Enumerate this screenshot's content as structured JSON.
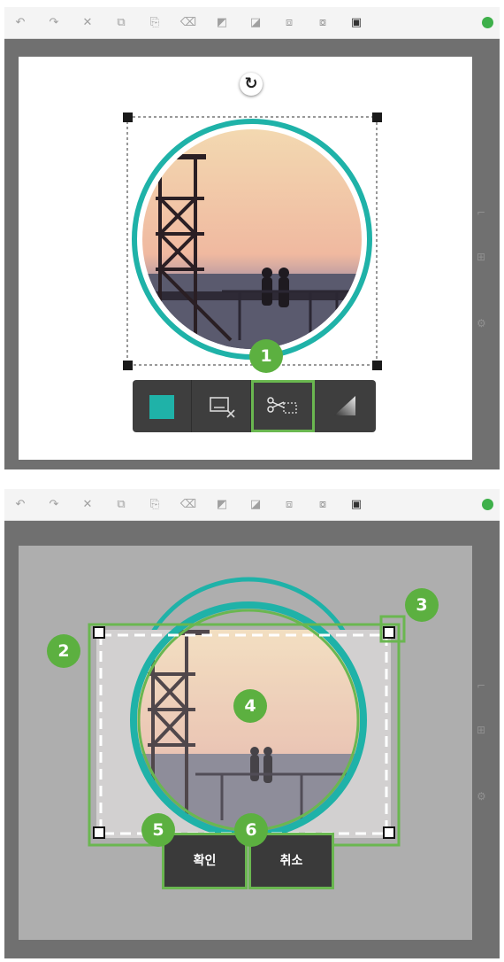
{
  "toolbar": {
    "items": [
      {
        "icon": "undo-icon",
        "glyph": "↶"
      },
      {
        "icon": "redo-icon",
        "glyph": "↷"
      },
      {
        "icon": "cut-icon",
        "glyph": "✕"
      },
      {
        "icon": "copy-icon",
        "glyph": "⧉"
      },
      {
        "icon": "paste-icon",
        "glyph": "⎘"
      },
      {
        "icon": "delete-icon",
        "glyph": "⌫"
      },
      {
        "icon": "bring-forward-icon",
        "glyph": "◩"
      },
      {
        "icon": "send-backward-icon",
        "glyph": "◪"
      },
      {
        "icon": "bring-to-front-icon",
        "glyph": "⧈"
      },
      {
        "icon": "send-to-back-icon",
        "glyph": "⧇"
      },
      {
        "icon": "align-icon",
        "glyph": "▣"
      }
    ],
    "help_icon": "help-icon"
  },
  "context_menu": {
    "items": [
      {
        "name": "fill-color-button",
        "icon": "color-swatch-icon",
        "color": "#1fb2a8"
      },
      {
        "name": "remove-background-button",
        "icon": "image-remove-icon"
      },
      {
        "name": "crop-button",
        "icon": "scissors-crop-icon"
      },
      {
        "name": "gradient-button",
        "icon": "gradient-icon"
      }
    ]
  },
  "crop_actions": {
    "confirm_label": "확인",
    "cancel_label": "취소"
  },
  "callouts": [
    "1",
    "2",
    "3",
    "4",
    "5",
    "6"
  ],
  "colors": {
    "accent": "#1fb2a8",
    "highlight": "#6ab750",
    "badge": "#5cb040"
  }
}
